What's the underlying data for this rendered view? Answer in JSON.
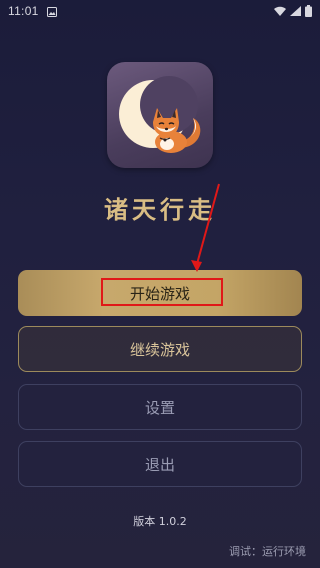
{
  "status_bar": {
    "time": "11:01",
    "left_icon": "image-icon",
    "right_icons": [
      "wifi-icon",
      "signal-icon",
      "battery-icon"
    ]
  },
  "app": {
    "logo_icon": "fox-moon-logo",
    "title": "诸天行走"
  },
  "menu": {
    "start_label": "开始游戏",
    "continue_label": "继续游戏",
    "settings_label": "设置",
    "exit_label": "退出"
  },
  "footer": {
    "version": "版本 1.0.2",
    "debug": "调试：运行环境"
  },
  "colors": {
    "accent_gold": "#c7a86c",
    "title_gold": "#d9bd84",
    "annotation_red": "#e01818",
    "background": "#1f1f3d"
  }
}
